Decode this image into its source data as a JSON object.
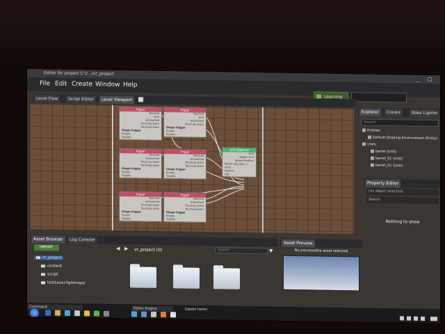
{
  "window": {
    "title": "Editor for project C:\\/…/vr_project"
  },
  "menu": {
    "items": [
      "File",
      "Edit",
      "Create",
      "Window",
      "Help"
    ],
    "learning": "Learning"
  },
  "tabs_top": {
    "level_flow": "Level Flow",
    "script_editor": "Script Editor",
    "level_viewport": "Level Viewport"
  },
  "explorer": {
    "tabs": [
      "Explorer",
      "Create",
      "Bake Lightm"
    ],
    "search_placeholder": "Search",
    "items": [
      "Entities",
      "Default Shading Environment (Entity)",
      "Units",
      "barrel (Unit)",
      "barrel_01 (Unit)",
      "barrel_02 (Unit)"
    ]
  },
  "property_editor": {
    "title": "Property Editor",
    "selected": "(no object selected)",
    "search_placeholder": "Search",
    "empty": "Nothing to show"
  },
  "flow_nodes": {
    "header": "Trigger",
    "rows": [
      "Touched",
      "Unit",
      "Untouched",
      "Touch by Actor",
      "Touching Actor",
      "Touch ing Ac..",
      "Shape trigger",
      "Enabled",
      "Enable",
      "Disable"
    ],
    "green_header": "Unit Spawned",
    "green_rows": [
      "Unit",
      "Spawn Unit",
      "Spawn Position",
      "Rotation",
      "Position",
      "Parent obj_color_s..",
      "Actor",
      "Out"
    ]
  },
  "asset_browser": {
    "tabs": [
      "Asset Browser",
      "Log Console"
    ],
    "import": "IMPORT",
    "tree": [
      "vr_project",
      "content",
      "script",
      "testLevel-lightmaps"
    ],
    "path": "vr_project (0)",
    "search_placeholder": "Search",
    "folders": 3
  },
  "asset_preview": {
    "title": "Asset Preview",
    "message": "No previewable asset selected"
  },
  "taskbar": {
    "group1": "Command",
    "group2": "Editor Engine",
    "delete_label": "Delete Items"
  },
  "colors": {
    "node_header": "#c44a66",
    "node_header_green": "#49b86a",
    "grid": "#6b4f3a",
    "accent": "#2e5f98"
  }
}
